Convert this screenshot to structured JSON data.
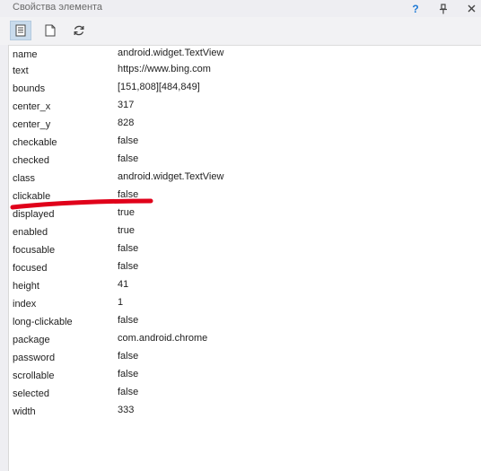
{
  "window": {
    "title": "Свойства элемента",
    "help_label": "?",
    "icons": [
      "pin-icon",
      "close-icon"
    ]
  },
  "toolbar": {
    "icons": [
      "properties-icon",
      "page-icon",
      "refresh-icon"
    ],
    "active": "properties-icon"
  },
  "colors": {
    "annotation": "#e0001a",
    "selected_tool": "#c9dbec"
  },
  "properties": [
    {
      "name": "name",
      "value": "android.widget.TextView"
    },
    {
      "name": "text",
      "value": "https://www.bing.com"
    },
    {
      "name": "bounds",
      "value": "[151,808][484,849]"
    },
    {
      "name": "center_x",
      "value": "317"
    },
    {
      "name": "center_y",
      "value": "828"
    },
    {
      "name": "checkable",
      "value": "false"
    },
    {
      "name": "checked",
      "value": "false"
    },
    {
      "name": "class",
      "value": "android.widget.TextView"
    },
    {
      "name": "clickable",
      "value": "false"
    },
    {
      "name": "displayed",
      "value": "true"
    },
    {
      "name": "enabled",
      "value": "true"
    },
    {
      "name": "focusable",
      "value": "false"
    },
    {
      "name": "focused",
      "value": "false"
    },
    {
      "name": "height",
      "value": "41"
    },
    {
      "name": "index",
      "value": "1"
    },
    {
      "name": "long-clickable",
      "value": "false"
    },
    {
      "name": "package",
      "value": "com.android.chrome"
    },
    {
      "name": "password",
      "value": "false"
    },
    {
      "name": "scrollable",
      "value": "false"
    },
    {
      "name": "selected",
      "value": "false"
    },
    {
      "name": "width",
      "value": "333"
    }
  ]
}
